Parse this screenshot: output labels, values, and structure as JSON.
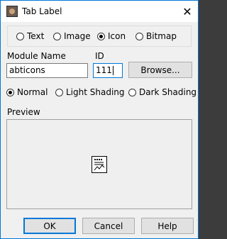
{
  "window": {
    "title": "Tab Label",
    "close_glyph": "✕"
  },
  "label_type": {
    "options": [
      {
        "label": "Text",
        "selected": false
      },
      {
        "label": "Image",
        "selected": false
      },
      {
        "label": "Icon",
        "selected": true
      },
      {
        "label": "Bitmap",
        "selected": false
      }
    ]
  },
  "module_name": {
    "label": "Module Name",
    "value": "abticons"
  },
  "id_field": {
    "label": "ID",
    "value": "111"
  },
  "browse_label": "Browse...",
  "shading": {
    "options": [
      {
        "label": "Normal",
        "selected": true
      },
      {
        "label": "Light Shading",
        "selected": false
      },
      {
        "label": "Dark Shading",
        "selected": false
      }
    ]
  },
  "preview": {
    "label": "Preview",
    "icon": "document-chart-icon"
  },
  "buttons": {
    "ok": "OK",
    "cancel": "Cancel",
    "help": "Help"
  },
  "colors": {
    "accent": "#0078d7",
    "dialog_bg": "#f0f0f0"
  }
}
